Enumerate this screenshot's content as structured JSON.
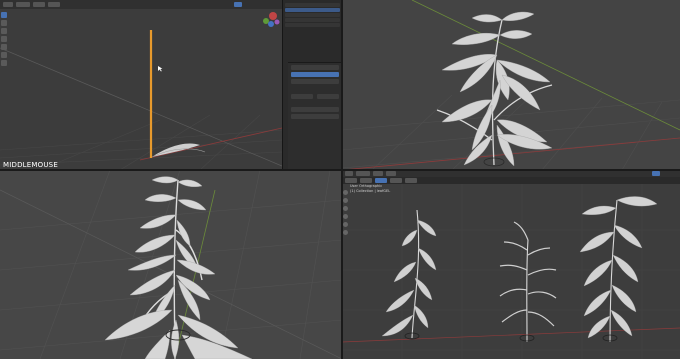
{
  "viewport_top_left": {
    "overlay_text": "MIDDLEMOUSE"
  },
  "viewport_bottom_right": {
    "overlay_line1": "User Orthographic",
    "overlay_line2": "(1) Collection | leafGEL"
  },
  "colors": {
    "viewport_bg": "#3c3c3c",
    "grid_line": "#4a4a4a",
    "axis_red": "#9a3b3b",
    "axis_green": "#6b8b3a",
    "selected_object": "#e89a2c",
    "leaf_fill": "#cfcfcf",
    "ui_blue": "#4772b3"
  },
  "icons": [
    "navigation-gizmo-icon",
    "tool-select-icon",
    "tool-move-icon",
    "tool-rotate-icon",
    "tool-scale-icon"
  ]
}
